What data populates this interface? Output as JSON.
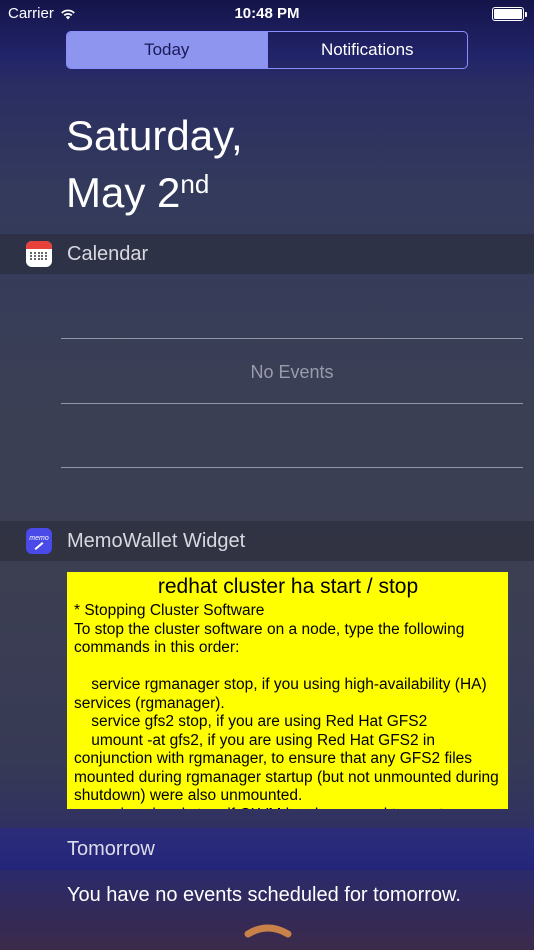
{
  "status_bar": {
    "carrier": "Carrier",
    "time": "10:48 PM",
    "battery_level": 1.0
  },
  "tabs": [
    {
      "label": "Today",
      "active": true
    },
    {
      "label": "Notifications",
      "active": false
    }
  ],
  "date": {
    "weekday": "Saturday,",
    "month_day": "May 2",
    "suffix": "nd"
  },
  "calendar": {
    "title": "Calendar",
    "empty_text": "No Events"
  },
  "memo_widget": {
    "title": "MemoWallet Widget",
    "memo_title": "redhat cluster ha start / stop",
    "memo_body": "* Stopping Cluster Software\nTo stop the cluster software on a node, type the following commands in this order:\n\n    service rgmanager stop, if you using high-availability (HA) services (rgmanager).\n    service gfs2 stop, if you are using Red Hat GFS2\n    umount -at gfs2, if you are using Red Hat GFS2 in conjunction with rgmanager, to ensure that any GFS2 files mounted during rgmanager startup (but not unmounted during shutdown) were also unmounted.\n    service clvmd stop, if CLVM has been used to create"
  },
  "tomorrow": {
    "title": "Tomorrow",
    "text": "You have no events scheduled for tomorrow."
  },
  "colors": {
    "segment_active": "#8e95ee",
    "memo_background": "#ffff00",
    "calendar_icon_red": "#e8403a",
    "memo_icon_blue": "#4a4ae8",
    "grabber": "#c9814a"
  },
  "icons": {
    "wifi": "wifi-icon",
    "battery": "battery-icon",
    "calendar": "calendar-app-icon",
    "memo": "memowallet-app-icon",
    "grabber": "chevron-up-grabber"
  }
}
